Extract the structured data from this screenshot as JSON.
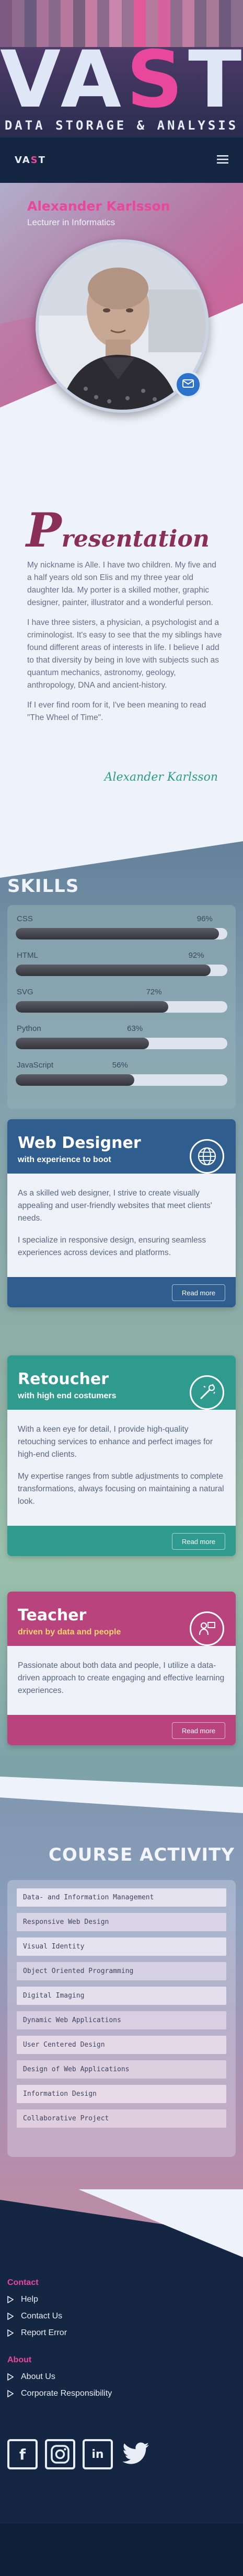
{
  "hero": {
    "logo_prefix": "VA",
    "logo_accent": "S",
    "logo_suffix": "T",
    "subtitle": "DATA STORAGE & ANALYSIS"
  },
  "nav": {
    "logo_prefix": "VA",
    "logo_accent": "S",
    "logo_suffix": "T",
    "menu_icon": "hamburger-icon"
  },
  "profile": {
    "name": "Alexander Karlsson",
    "role": "Lecturer in Informatics",
    "mail_icon": "mail-icon"
  },
  "presentation": {
    "title_initial": "P",
    "title_rest": "resentation",
    "paragraphs": [
      "My nickname is Alle. I have two children. My five and a half years old son Elis and my three year old daughter Ida. My porter is a skilled mother, graphic designer, painter, illustrator and a wonderful person.",
      "I have three sisters, a physician, a psychologist and a criminologist. It's easy to see that the my siblings have found different areas of interests in life. I believe I add to that diversity by being in love with subjects such as quantum mechanics, astronomy, geology, anthropology, DNA and ancient-history.",
      "If I ever find room for it, I've been meaning to read \"The Wheel of Time\"."
    ],
    "signature": "Alexander Karlsson"
  },
  "skills": {
    "title": "SKILLS",
    "items": [
      {
        "name": "CSS",
        "percent_label": "96%",
        "level": 0.96
      },
      {
        "name": "HTML",
        "percent_label": "92%",
        "level": 0.92
      },
      {
        "name": "SVG",
        "percent_label": "72%",
        "level": 0.72
      },
      {
        "name": "Python",
        "percent_label": "63%",
        "level": 0.63
      },
      {
        "name": "JavaScript",
        "percent_label": "56%",
        "level": 0.56
      }
    ]
  },
  "cards": [
    {
      "title": "Web Designer",
      "subtitle": "with experience to boot",
      "icon": "globe-icon",
      "color": "#2f5d8e",
      "sub_color": "#ffffff",
      "paragraphs": [
        "As a skilled web designer, I strive to create visually appealing and user-friendly websites that meet clients' needs.",
        "I specialize in responsive design, ensuring seamless experiences across devices and platforms."
      ],
      "read_more": "Read more"
    },
    {
      "title": "Retoucher",
      "subtitle": "with high end costumers",
      "icon": "retouch-wand-icon",
      "color": "#2f9a8e",
      "sub_color": "#ffffff",
      "paragraphs": [
        "With a keen eye for detail, I provide high-quality retouching services to enhance and perfect images for high-end clients.",
        "My expertise ranges from subtle adjustments to complete transformations, always focusing on maintaining a natural look."
      ],
      "read_more": "Read more"
    },
    {
      "title": "Teacher",
      "subtitle": "driven by data and people",
      "icon": "teacher-icon",
      "color": "#b8437d",
      "sub_color": "#f3d36b",
      "paragraphs": [
        "Passionate about both data and people, I utilize a data-driven approach to create engaging and effective learning experiences."
      ],
      "read_more": "Read more"
    }
  ],
  "course_activity": {
    "title": "COURSE ACTIVITY",
    "items": [
      "Data- and Information Management",
      "Responsive Web Design",
      "Visual Identity",
      "Object Oriented Programming",
      "Digital Imaging",
      "Dynamic Web Applications",
      "User Centered Design",
      "Design of Web Applications",
      "Information Design",
      "Collaborative Project"
    ]
  },
  "footer": {
    "contact_heading": "Contact",
    "contact_links": [
      "Help",
      "Contact Us",
      "Report Error"
    ],
    "about_heading": "About",
    "about_links": [
      "About Us",
      "Corporate Responsibility"
    ],
    "social_icons": [
      "facebook-icon",
      "instagram-icon",
      "linkedin-icon",
      "twitter-icon"
    ],
    "social_glyphs": [
      "f",
      "in"
    ]
  }
}
